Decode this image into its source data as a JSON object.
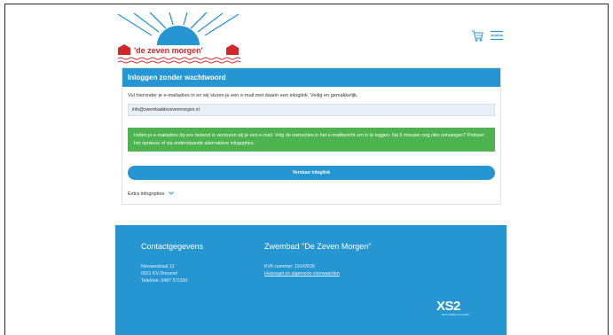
{
  "brand": {
    "logo_text": "'de zeven morgen'",
    "colors": {
      "primary": "#2596d1",
      "success": "#4db34e",
      "logo_red": "#d1272a",
      "sun": "#2596d1"
    }
  },
  "header": {
    "icons": [
      "cart-icon",
      "menu-icon"
    ]
  },
  "login": {
    "title": "Inloggen zonder wachtwoord",
    "intro": "Vul hieronder je e-mailadres in en wij sturen je een e-mail met daarin een inloglink. Veilig en gemakkelijk.",
    "email_value": "info@zwembaddezevenmorgen.nl",
    "alert_text": "Indien je e-mailadres bij ons bekend is versturen wij je een e-mail. Volg de instructies in het e-mailbericht om in te loggen. Na 5 minuten nog niks ontvangen? Probeer het opnieuw of via onderstaande alternatieve inlogopties.",
    "submit_label": "Verstuur inloglink",
    "extra_label": "Extra inlogopties"
  },
  "footer": {
    "contact_title": "Contactgegevens",
    "address": "Nieuwestraat 12",
    "postal": "6621 KV Dreumel",
    "phone": "Telefoon: 0487 571591",
    "org_title": "Zwembad \"De Zeven Morgen\"",
    "kvk": "KVK-nummer: 11042635",
    "terms_link": "Huisregel en algemene voorwaarden",
    "partner_logo": "XS2",
    "partner_tagline": "KEYS WHERE YOU ENTER"
  }
}
